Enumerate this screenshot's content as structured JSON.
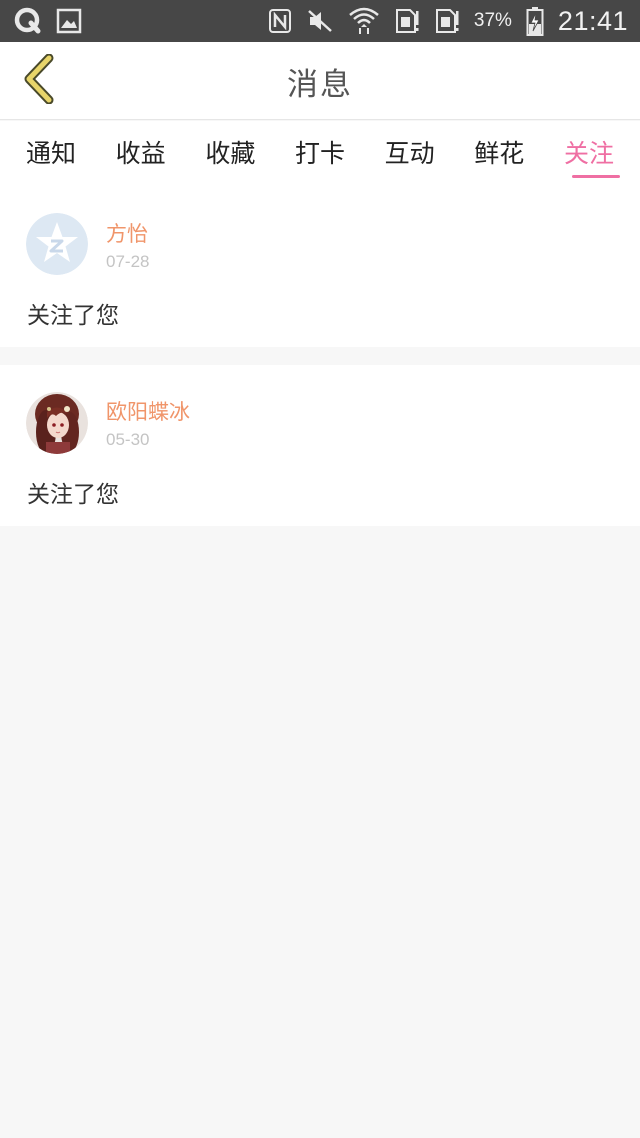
{
  "status_bar": {
    "battery_percent": "37%",
    "time": "21:41",
    "icons": [
      "q-app-icon",
      "gallery-icon",
      "nfc-icon",
      "mute-icon",
      "wifi-icon",
      "sim1-icon",
      "sim2-icon",
      "battery-charging-icon"
    ]
  },
  "header": {
    "title": "消息",
    "back_icon": "chevron-left-icon",
    "accent_color": "#e8d56a"
  },
  "tabs": {
    "items": [
      {
        "label": "通知"
      },
      {
        "label": "收益"
      },
      {
        "label": "收藏"
      },
      {
        "label": "打卡"
      },
      {
        "label": "互动"
      },
      {
        "label": "鲜花"
      },
      {
        "label": "关注"
      }
    ],
    "active_index": 6,
    "active_color": "#ef6fa3"
  },
  "messages": [
    {
      "name": "方怡",
      "date": "07-28",
      "text": "关注了您",
      "avatar": "default-avatar-icon"
    },
    {
      "name": "欧阳蝶冰",
      "date": "05-30",
      "text": "关注了您",
      "avatar": "user-avatar-image"
    }
  ],
  "colors": {
    "name": "#f0956a",
    "date": "#c4c4c4",
    "background": "#f7f7f7"
  }
}
